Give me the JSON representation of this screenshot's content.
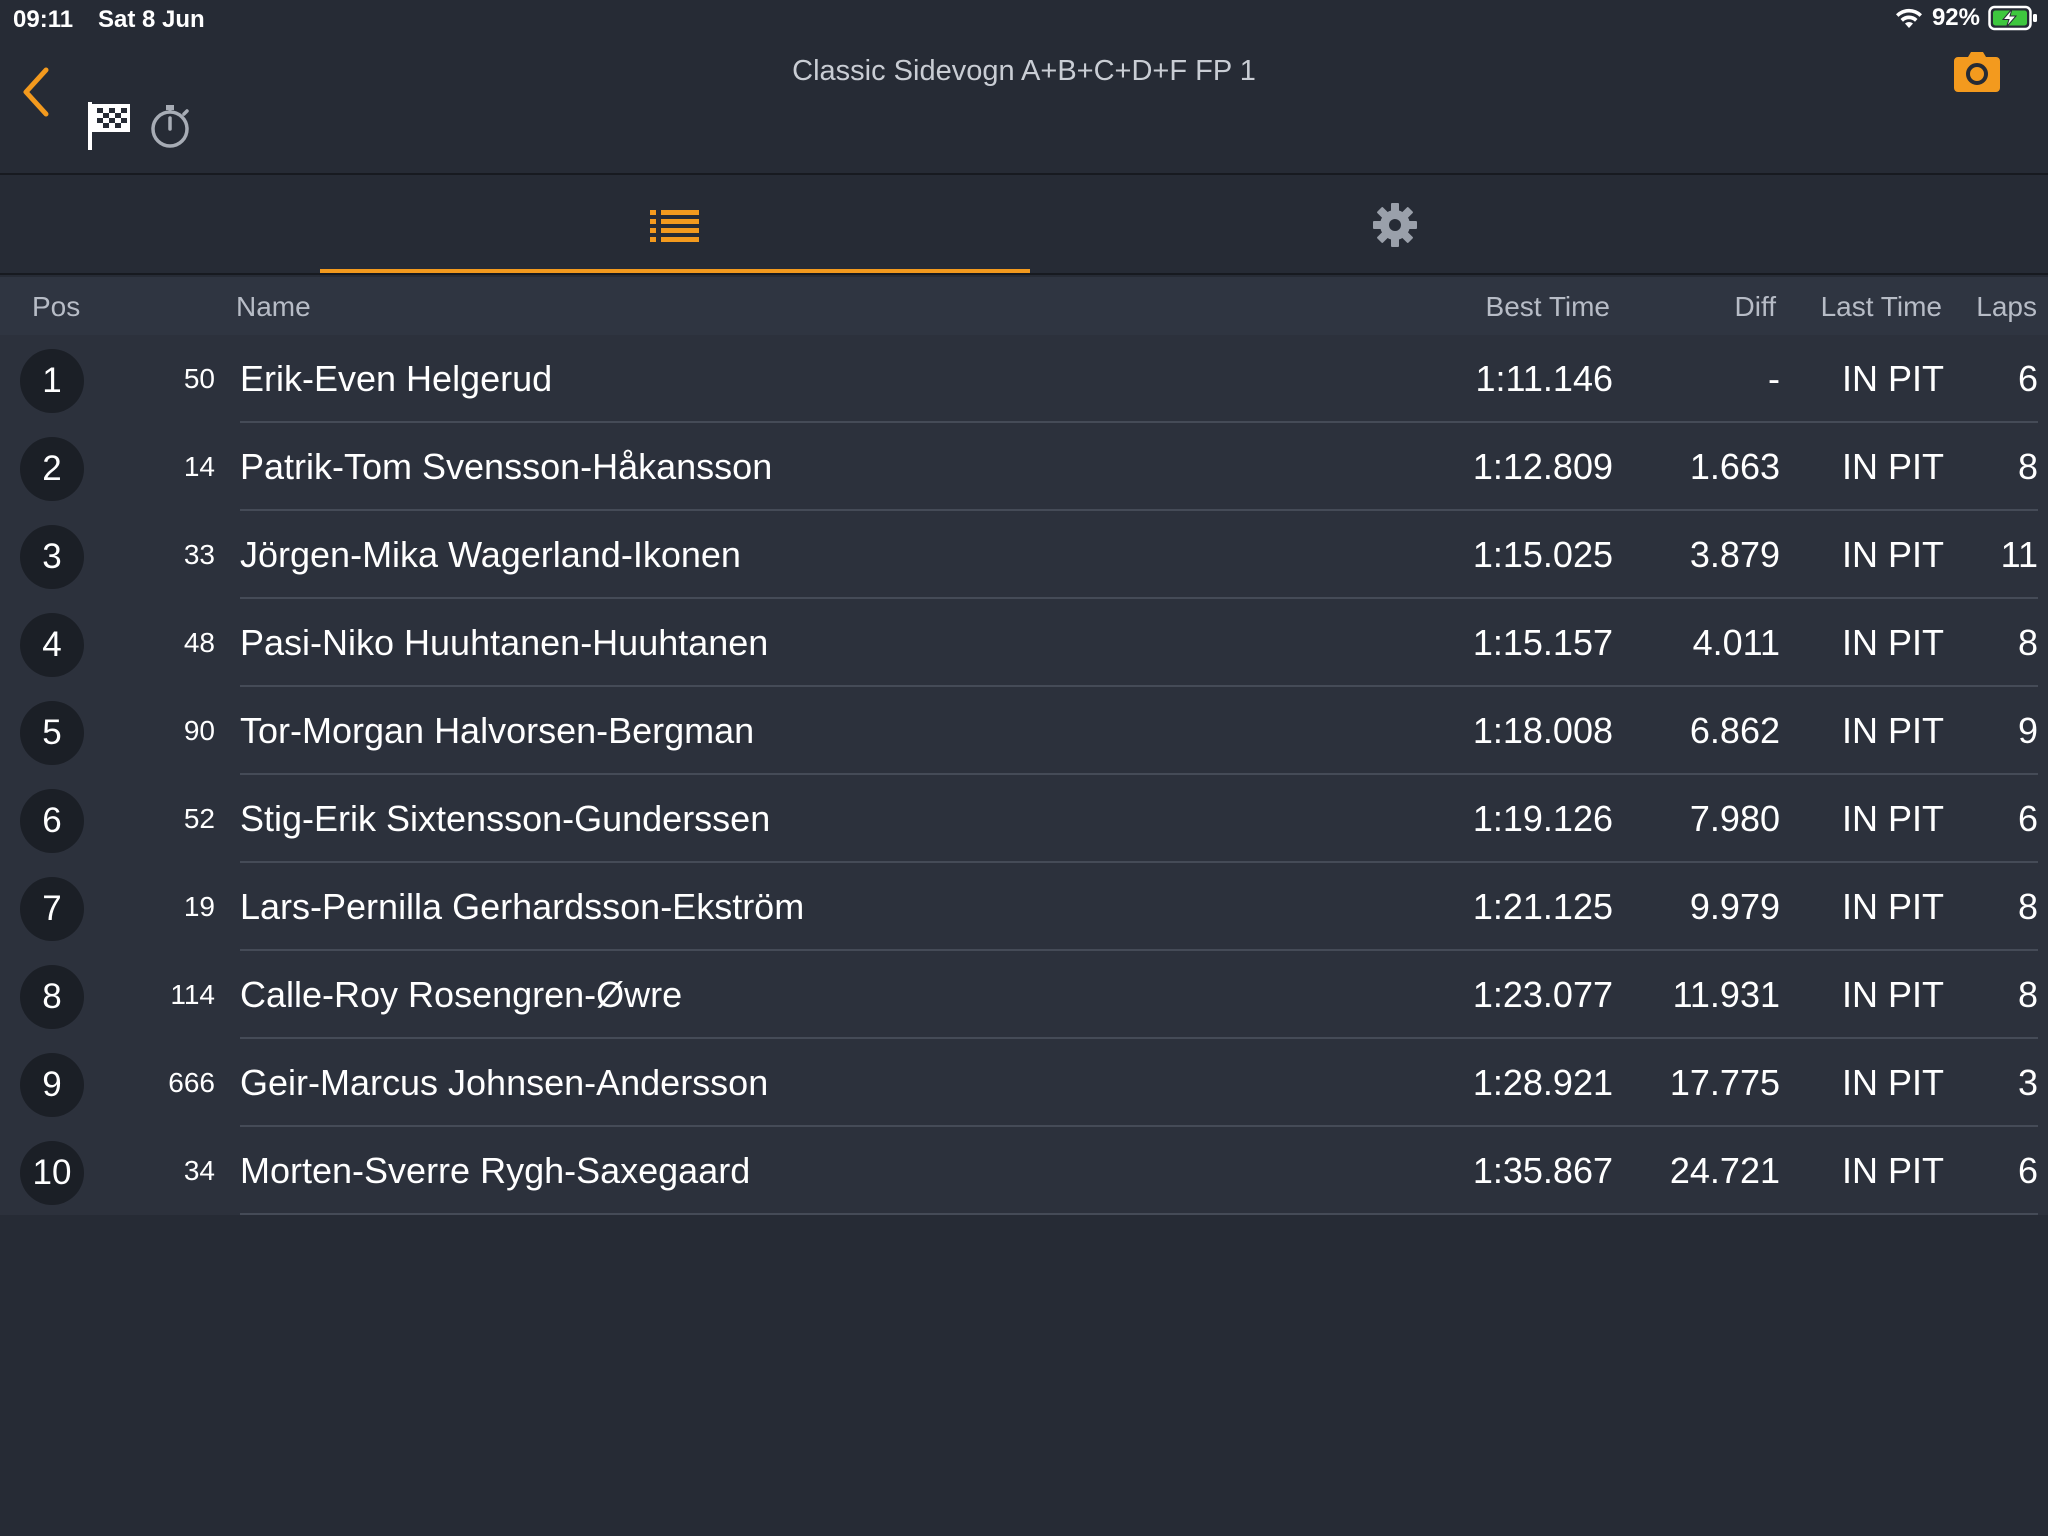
{
  "status": {
    "time": "09:11",
    "date": "Sat 8 Jun",
    "battery": "92%"
  },
  "nav": {
    "title": "Classic Sidevogn A+B+C+D+F FP 1"
  },
  "colors": {
    "accent": "#f39a1e",
    "background": "#262b35",
    "row": "#2c313c",
    "header": "#2f3541"
  },
  "table": {
    "headers": {
      "pos": "Pos",
      "name": "Name",
      "best": "Best Time",
      "diff": "Diff",
      "last": "Last Time",
      "laps": "Laps"
    },
    "rows": [
      {
        "pos": "1",
        "num": "50",
        "name": "Erik-Even Helgerud",
        "best": "1:11.146",
        "diff": "-",
        "last": "IN PIT",
        "laps": "6"
      },
      {
        "pos": "2",
        "num": "14",
        "name": "Patrik-Tom Svensson-Håkansson",
        "best": "1:12.809",
        "diff": "1.663",
        "last": "IN PIT",
        "laps": "8"
      },
      {
        "pos": "3",
        "num": "33",
        "name": "Jörgen-Mika Wagerland-Ikonen",
        "best": "1:15.025",
        "diff": "3.879",
        "last": "IN PIT",
        "laps": "11"
      },
      {
        "pos": "4",
        "num": "48",
        "name": "Pasi-Niko Huuhtanen-Huuhtanen",
        "best": "1:15.157",
        "diff": "4.011",
        "last": "IN PIT",
        "laps": "8"
      },
      {
        "pos": "5",
        "num": "90",
        "name": "Tor-Morgan Halvorsen-Bergman",
        "best": "1:18.008",
        "diff": "6.862",
        "last": "IN PIT",
        "laps": "9"
      },
      {
        "pos": "6",
        "num": "52",
        "name": "Stig-Erik Sixtensson-Gunderssen",
        "best": "1:19.126",
        "diff": "7.980",
        "last": "IN PIT",
        "laps": "6"
      },
      {
        "pos": "7",
        "num": "19",
        "name": "Lars-Pernilla Gerhardsson-Ekström",
        "best": "1:21.125",
        "diff": "9.979",
        "last": "IN PIT",
        "laps": "8"
      },
      {
        "pos": "8",
        "num": "114",
        "name": "Calle-Roy Rosengren-Øwre",
        "best": "1:23.077",
        "diff": "11.931",
        "last": "IN PIT",
        "laps": "8"
      },
      {
        "pos": "9",
        "num": "666",
        "name": "Geir-Marcus Johnsen-Andersson",
        "best": "1:28.921",
        "diff": "17.775",
        "last": "IN PIT",
        "laps": "3"
      },
      {
        "pos": "10",
        "num": "34",
        "name": "Morten-Sverre Rygh-Saxegaard",
        "best": "1:35.867",
        "diff": "24.721",
        "last": "IN PIT",
        "laps": "6"
      }
    ]
  }
}
